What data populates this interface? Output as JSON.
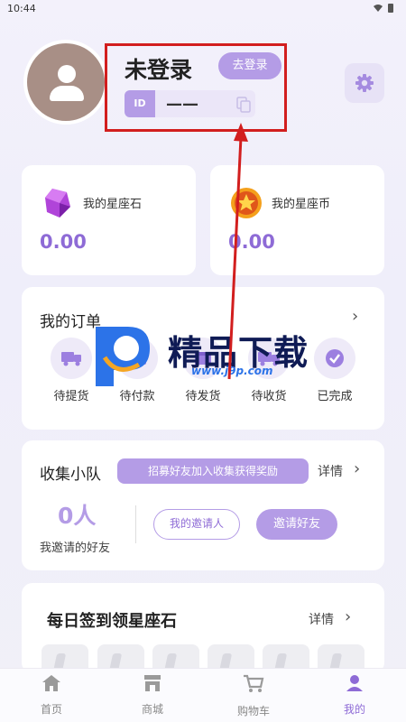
{
  "status_bar": {
    "time": "10:44"
  },
  "profile": {
    "title": "未登录",
    "login_button": "去登录",
    "id_label": "ID",
    "id_value": "——"
  },
  "wallet": {
    "gems": {
      "title": "我的星座石",
      "value": "0.00"
    },
    "coins": {
      "title": "我的星座币",
      "value": "0.00"
    }
  },
  "orders": {
    "title": "我的订单",
    "items": [
      {
        "label": "待提货",
        "icon": "truck-icon"
      },
      {
        "label": "待付款",
        "icon": "wallet-icon"
      },
      {
        "label": "待发货",
        "icon": "box-icon"
      },
      {
        "label": "待收货",
        "icon": "delivery-icon"
      },
      {
        "label": "已完成",
        "icon": "check-icon"
      }
    ]
  },
  "squad": {
    "title": "收集小队",
    "banner": "招募好友加入收集获得奖励",
    "detail": "详情",
    "count": "0人",
    "count_label": "我邀请的好友",
    "invited_button": "我的邀请人",
    "invite_button": "邀请好友"
  },
  "checkin": {
    "title": "每日签到领星座石",
    "detail": "详情"
  },
  "watermark": {
    "title": "精品下载",
    "url": "www.j9p.com"
  },
  "tabbar": {
    "items": [
      {
        "label": "首页",
        "icon": "home-icon"
      },
      {
        "label": "商城",
        "icon": "store-icon"
      },
      {
        "label": "购物车",
        "icon": "cart-icon"
      },
      {
        "label": "我的",
        "icon": "user-icon"
      }
    ]
  },
  "colors": {
    "accent": "#b49ce6",
    "accent_dark": "#8e6bd6",
    "annotation": "#d21e1e"
  }
}
